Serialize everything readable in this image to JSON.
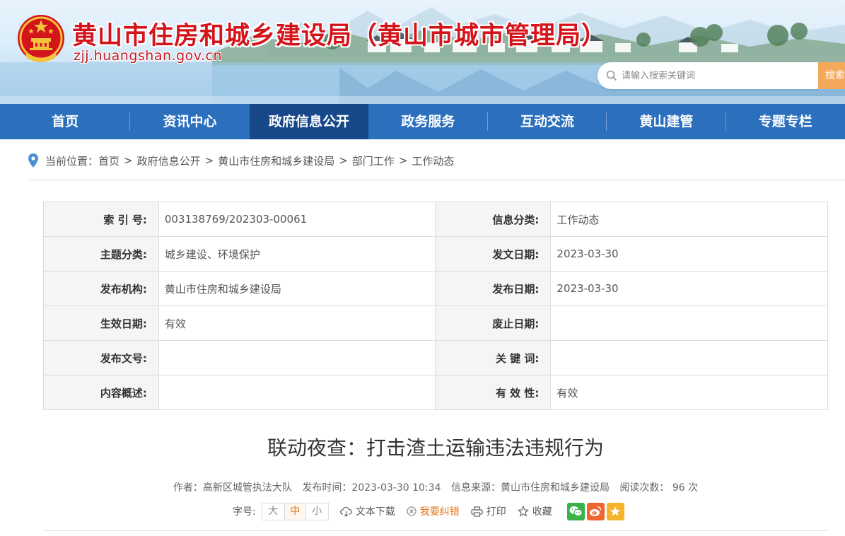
{
  "header": {
    "title": "黄山市住房和城乡建设局（黄山市城市管理局）",
    "url": "zjj.huangshan.gov.cn",
    "search_placeholder": "请输入搜索关键词",
    "search_button": "搜索",
    "emblem_icon": "national-emblem-icon"
  },
  "nav": {
    "items": [
      {
        "label": "首页"
      },
      {
        "label": "资讯中心"
      },
      {
        "label": "政府信息公开",
        "active": true
      },
      {
        "label": "政务服务"
      },
      {
        "label": "互动交流"
      },
      {
        "label": "黄山建管"
      },
      {
        "label": "专题专栏"
      }
    ]
  },
  "breadcrumb": {
    "prefix": "当前位置：",
    "items": [
      "首页",
      "政府信息公开",
      "黄山市住房和城乡建设局",
      "部门工作",
      "工作动态"
    ],
    "separator": ">"
  },
  "info_table": {
    "rows": [
      {
        "l1": "索 引 号:",
        "v1": "003138769/202303-00061",
        "l2": "信息分类:",
        "v2": "工作动态"
      },
      {
        "l1": "主题分类:",
        "v1": "城乡建设、环境保护",
        "l2": "发文日期:",
        "v2": "2023-03-30"
      },
      {
        "l1": "发布机构:",
        "v1": "黄山市住房和城乡建设局",
        "l2": "发布日期:",
        "v2": "2023-03-30"
      },
      {
        "l1": "生效日期:",
        "v1": "有效",
        "l2": "废止日期:",
        "v2": ""
      },
      {
        "l1": "发布文号:",
        "v1": "",
        "l2": "关 键 词:",
        "v2": ""
      },
      {
        "l1": "内容概述:",
        "v1": "",
        "l2": "有 效 性:",
        "v2": "有效"
      }
    ]
  },
  "article": {
    "title": "联动夜查：打击渣土运输违法违规行为",
    "meta": {
      "author": "作者：高新区城管执法大队",
      "publish_time": "发布时间：2023-03-30 10:34",
      "source": "信息来源：黄山市住房和城乡建设局",
      "views": "阅读次数： 96 次"
    },
    "tools": {
      "font_label": "字号:",
      "font_large": "大",
      "font_medium": "中",
      "font_small": "小",
      "download": "文本下载",
      "report_error": "我要纠错",
      "print": "打印",
      "favorite": "收藏"
    }
  },
  "colors": {
    "nav_bg": "#2b6fbd",
    "nav_active": "#16488a",
    "title_red": "#d4141b",
    "search_button": "#f4a85b",
    "accent_orange": "#e07a1f"
  }
}
